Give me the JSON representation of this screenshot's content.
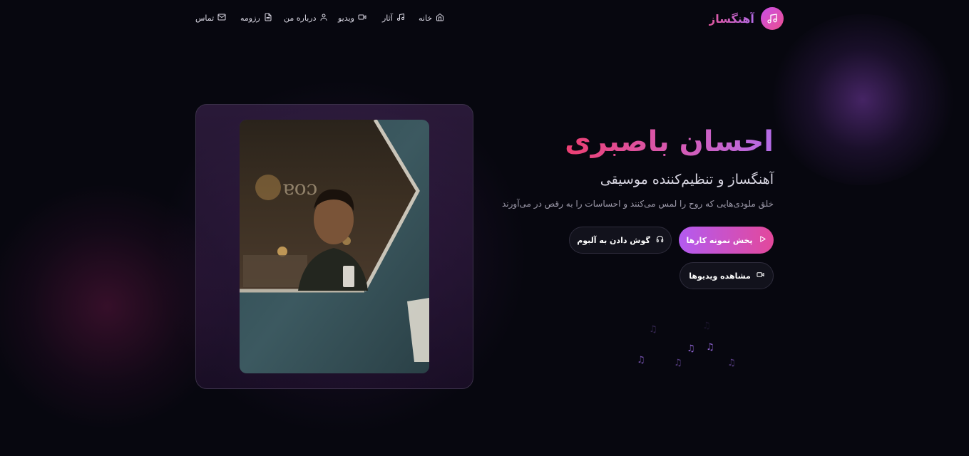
{
  "brand": {
    "name": "آهنگساز",
    "icon": "music-note-icon",
    "gradient": [
      "#c94fe8",
      "#ec4f8f"
    ]
  },
  "nav": {
    "items": [
      {
        "label": "خانه",
        "icon": "home-icon"
      },
      {
        "label": "آثار",
        "icon": "music-note-icon"
      },
      {
        "label": "ویدیو",
        "icon": "video-icon"
      },
      {
        "label": "درباره من",
        "icon": "user-icon"
      },
      {
        "label": "رزومه",
        "icon": "document-icon"
      },
      {
        "label": "تماس",
        "icon": "mail-icon"
      }
    ]
  },
  "hero": {
    "name": "احسان باصبری",
    "subtitle": "آهنگساز و تنظیم‌کننده موسیقی",
    "description": "خلق ملودی‌هایی که روح را لمس می‌کنند و احساسات را به رقص در می‌آورند",
    "buttons": {
      "play_samples": "پخش نمونه کارها",
      "listen_album": "گوش دادن به آلبوم",
      "watch_videos": "مشاهده ویدیوها"
    }
  },
  "colors": {
    "accent_pink": "#ec3f72",
    "accent_purple": "#b46ce8",
    "background": "#07070f"
  }
}
